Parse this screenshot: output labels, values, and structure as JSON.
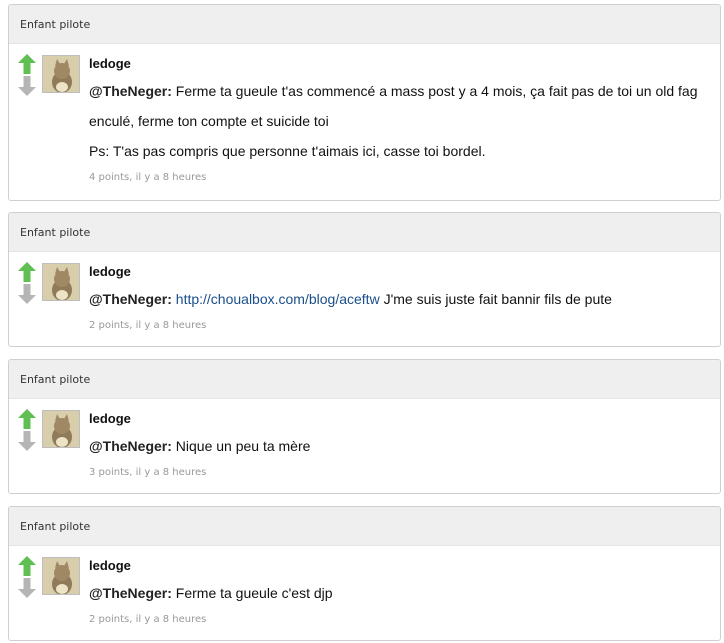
{
  "comments": [
    {
      "group": "Enfant pilote",
      "author": "ledoge",
      "mention": "@TheNeger:",
      "text_lines": [
        "Ferme ta gueule t'as commencé a mass post y a 4 mois, ça fait pas de toi un old fag enculé, ferme ton compte et suicide toi",
        "Ps: T'as pas compris que personne t'aimais ici, casse toi bordel."
      ],
      "meta": "4 points, il y a 8 heures"
    },
    {
      "group": "Enfant pilote",
      "author": "ledoge",
      "mention": "@TheNeger:",
      "link": "http://choualbox.com/blog/aceftw",
      "text_after_link": " J'me suis juste fait bannir fils de pute",
      "meta": "2 points, il y a 8 heures"
    },
    {
      "group": "Enfant pilote",
      "author": "ledoge",
      "mention": "@TheNeger:",
      "text": " Nique un peu ta mère",
      "meta": "3 points, il y a 8 heures"
    },
    {
      "group": "Enfant pilote",
      "author": "ledoge",
      "mention": "@TheNeger:",
      "text": " Ferme ta gueule c'est djp",
      "meta": "2 points, il y a 8 heures"
    }
  ],
  "colors": {
    "upvote": "#5fbf53",
    "downvote": "#b5b5b5",
    "link": "#1a4f8b",
    "meta": "#999999",
    "header_bg": "#efefef"
  },
  "icons": {
    "upvote": "arrow-up-icon",
    "downvote": "arrow-down-icon",
    "avatar": "cat-avatar"
  }
}
